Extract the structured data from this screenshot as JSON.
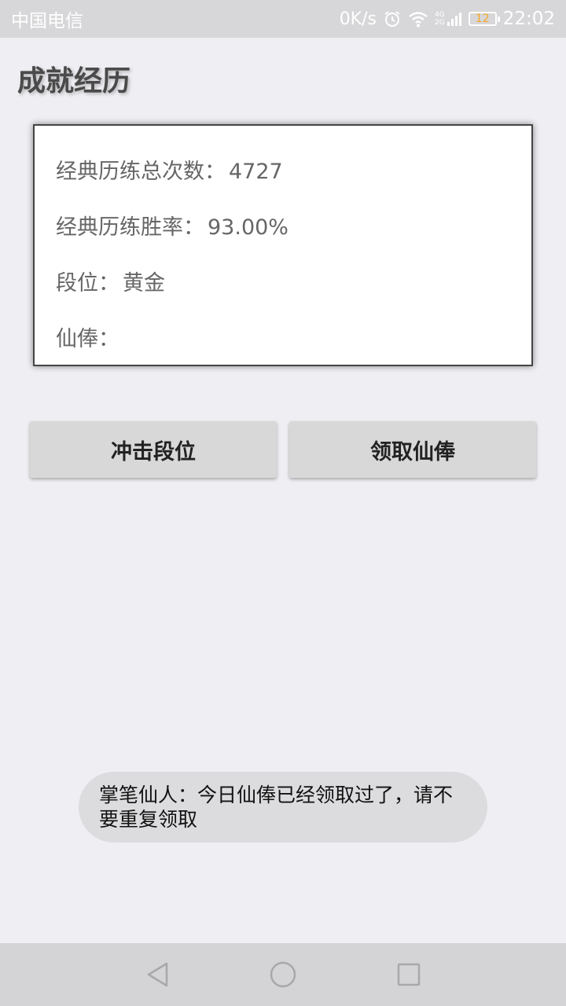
{
  "status_bar": {
    "carrier": "中国电信",
    "net_speed": "0K/s",
    "network_type_top": "4G",
    "network_type_bottom": "2G",
    "battery_level": "12",
    "time": "22:02",
    "icons": [
      "alarm-icon",
      "wifi-icon",
      "signal-icon",
      "battery-icon"
    ]
  },
  "page": {
    "title": "成就经历"
  },
  "stats": {
    "total_label": "经典历练总次数：",
    "total_value": "4727",
    "winrate_label": "经典历练胜率：",
    "winrate_value": "93.00%",
    "rank_label": "段位：",
    "rank_value": "黄金",
    "salary_label": "仙俸：",
    "salary_value": ""
  },
  "actions": {
    "rank_up_label": "冲击段位",
    "claim_salary_label": "领取仙俸"
  },
  "toast": {
    "message": "掌笔仙人：今日仙俸已经领取过了，请不要重复领取"
  },
  "nav_bar": {
    "icons": [
      "back-icon",
      "home-icon",
      "recents-icon"
    ]
  },
  "colors": {
    "background": "#efeff3",
    "status_bar": "#d7d7d9",
    "button": "#d8d8d8",
    "battery_level": "#f5a623"
  }
}
